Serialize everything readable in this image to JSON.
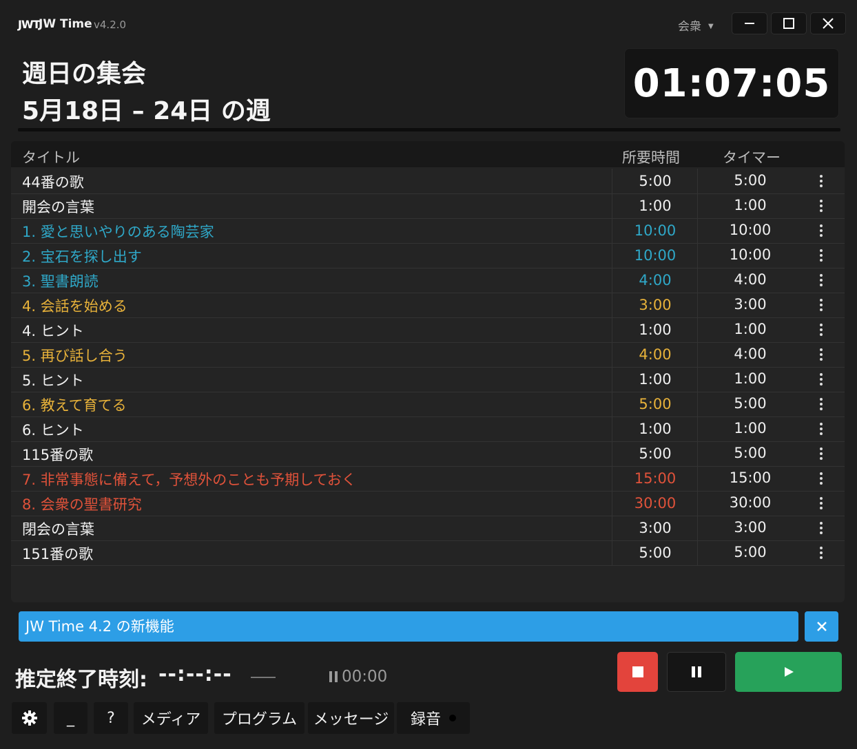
{
  "app": {
    "logo": "JWT",
    "name": "JW Time",
    "version": "v4.2.0",
    "mode": "会衆"
  },
  "header": {
    "title": "週日の集会",
    "week": "5月18日 – 24日 の週",
    "clock": "01:07:05"
  },
  "table": {
    "col_title": "タイトル",
    "col_duration": "所要時間",
    "col_timer": "タイマー",
    "rows": [
      {
        "title": "44番の歌",
        "duration": "5:00",
        "timer": "5:00",
        "color": "#f0f0f0"
      },
      {
        "title": "開会の言葉",
        "duration": "1:00",
        "timer": "1:00",
        "color": "#f0f0f0"
      },
      {
        "title": "1. 愛と思いやりのある陶芸家",
        "duration": "10:00",
        "timer": "10:00",
        "color": "#2fa8c8"
      },
      {
        "title": "2. 宝石を探し出す",
        "duration": "10:00",
        "timer": "10:00",
        "color": "#2fa8c8"
      },
      {
        "title": "3. 聖書朗読",
        "duration": "4:00",
        "timer": "4:00",
        "color": "#2fa8c8"
      },
      {
        "title": "4. 会話を始める",
        "duration": "3:00",
        "timer": "3:00",
        "color": "#e8b23a"
      },
      {
        "title": "4. ヒント",
        "duration": "1:00",
        "timer": "1:00",
        "color": "#f0f0f0"
      },
      {
        "title": "5. 再び話し合う",
        "duration": "4:00",
        "timer": "4:00",
        "color": "#e8b23a"
      },
      {
        "title": "5. ヒント",
        "duration": "1:00",
        "timer": "1:00",
        "color": "#f0f0f0"
      },
      {
        "title": "6. 教えて育てる",
        "duration": "5:00",
        "timer": "5:00",
        "color": "#e8b23a"
      },
      {
        "title": "6. ヒント",
        "duration": "1:00",
        "timer": "1:00",
        "color": "#f0f0f0"
      },
      {
        "title": "115番の歌",
        "duration": "5:00",
        "timer": "5:00",
        "color": "#f0f0f0"
      },
      {
        "title": "7. 非常事態に備えて，予想外のことも予期しておく",
        "duration": "15:00",
        "timer": "15:00",
        "color": "#e0523a"
      },
      {
        "title": "8. 会衆の聖書研究",
        "duration": "30:00",
        "timer": "30:00",
        "color": "#e0523a"
      },
      {
        "title": "閉会の言葉",
        "duration": "3:00",
        "timer": "3:00",
        "color": "#f0f0f0"
      },
      {
        "title": "151番の歌",
        "duration": "5:00",
        "timer": "5:00",
        "color": "#f0f0f0"
      }
    ]
  },
  "banner": {
    "text": "JW Time 4.2 の新機能"
  },
  "status": {
    "eta_label": "推定終了時刻:",
    "eta_value": "--:--:--",
    "paused_elapsed": "00:00"
  },
  "toolbar": {
    "media": "メディア",
    "program": "プログラム",
    "messages": "メッセージ",
    "record": "録音",
    "minimize": "_",
    "help": "?"
  },
  "colors": {
    "accent": "#2d9ee6",
    "stop": "#e3443c",
    "play": "#27a25a",
    "blue_section": "#2fa8c8",
    "gold_section": "#e8b23a",
    "red_section": "#e0523a"
  }
}
